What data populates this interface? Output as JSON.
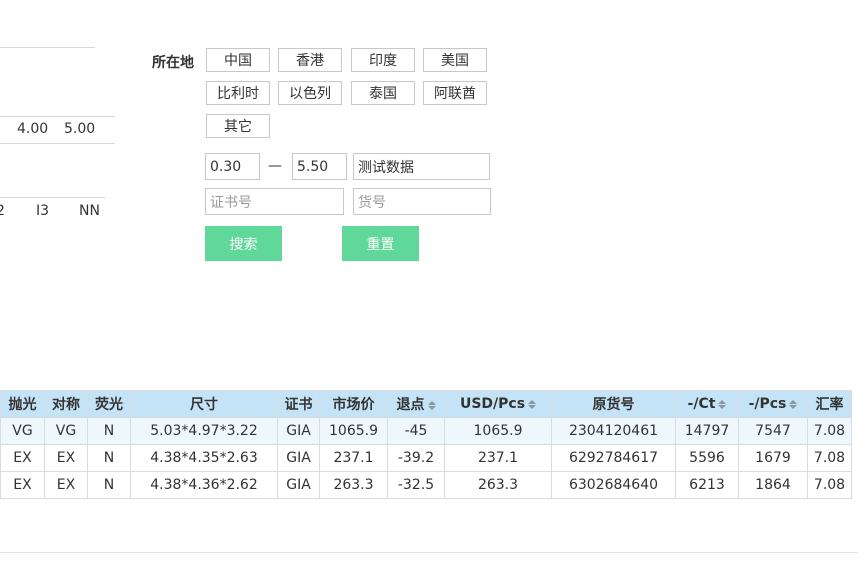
{
  "left_panel": {
    "row1": [
      "4.00",
      "5.00"
    ],
    "row2": [
      "2",
      "I3",
      "NN"
    ]
  },
  "filter": {
    "location_label": "所在地",
    "locations": [
      "中国",
      "香港",
      "印度",
      "美国",
      "比利时",
      "以色列",
      "泰国",
      "阿联酋",
      "其它"
    ],
    "size_min": "0.30",
    "size_sep": "—",
    "size_max": "5.50",
    "test_field": "测试数据",
    "cert_placeholder": "证书号",
    "stock_placeholder": "货号",
    "search_label": "搜索",
    "reset_label": "重置"
  },
  "table": {
    "headers": [
      "抛光",
      "对称",
      "荧光",
      "尺寸",
      "证书",
      "市场价",
      "退点",
      "USD/Pcs",
      "原货号",
      "-/Ct",
      "-/Pcs",
      "汇率"
    ],
    "rows": [
      [
        "VG",
        "VG",
        "N",
        "5.03*4.97*3.22",
        "GIA",
        "1065.9",
        "-45",
        "1065.9",
        "2304120461",
        "14797",
        "7547",
        "7.08"
      ],
      [
        "EX",
        "EX",
        "N",
        "4.38*4.35*2.63",
        "GIA",
        "237.1",
        "-39.2",
        "237.1",
        "6292784617",
        "5596",
        "1679",
        "7.08"
      ],
      [
        "EX",
        "EX",
        "N",
        "4.38*4.36*2.62",
        "GIA",
        "263.3",
        "-32.5",
        "263.3",
        "6302684640",
        "6213",
        "1864",
        "7.08"
      ]
    ]
  },
  "colors": {
    "accent_green": "#5fd89a",
    "header_blue": "#c5e3f6"
  }
}
